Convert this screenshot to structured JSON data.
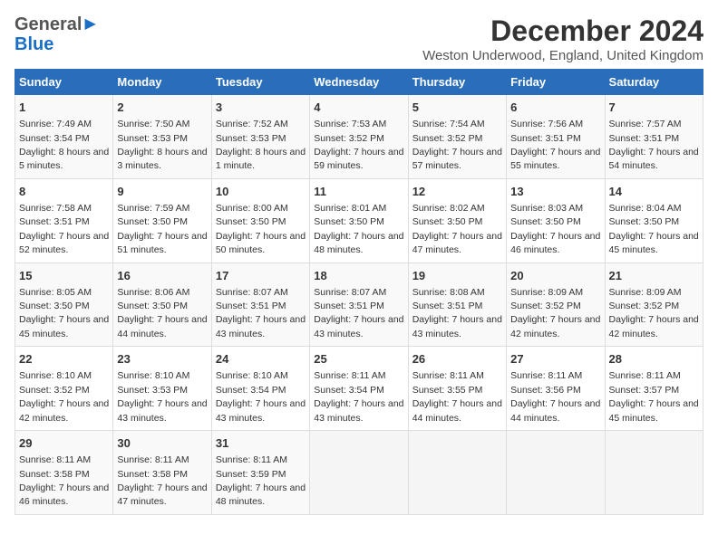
{
  "logo": {
    "line1": "General",
    "line2": "Blue",
    "icon": "▶"
  },
  "title": "December 2024",
  "subtitle": "Weston Underwood, England, United Kingdom",
  "weekdays": [
    "Sunday",
    "Monday",
    "Tuesday",
    "Wednesday",
    "Thursday",
    "Friday",
    "Saturday"
  ],
  "weeks": [
    [
      {
        "day": "1",
        "sunrise": "7:49 AM",
        "sunset": "3:54 PM",
        "daylight": "8 hours and 5 minutes."
      },
      {
        "day": "2",
        "sunrise": "7:50 AM",
        "sunset": "3:53 PM",
        "daylight": "8 hours and 3 minutes."
      },
      {
        "day": "3",
        "sunrise": "7:52 AM",
        "sunset": "3:53 PM",
        "daylight": "8 hours and 1 minute."
      },
      {
        "day": "4",
        "sunrise": "7:53 AM",
        "sunset": "3:52 PM",
        "daylight": "7 hours and 59 minutes."
      },
      {
        "day": "5",
        "sunrise": "7:54 AM",
        "sunset": "3:52 PM",
        "daylight": "7 hours and 57 minutes."
      },
      {
        "day": "6",
        "sunrise": "7:56 AM",
        "sunset": "3:51 PM",
        "daylight": "7 hours and 55 minutes."
      },
      {
        "day": "7",
        "sunrise": "7:57 AM",
        "sunset": "3:51 PM",
        "daylight": "7 hours and 54 minutes."
      }
    ],
    [
      {
        "day": "8",
        "sunrise": "7:58 AM",
        "sunset": "3:51 PM",
        "daylight": "7 hours and 52 minutes."
      },
      {
        "day": "9",
        "sunrise": "7:59 AM",
        "sunset": "3:50 PM",
        "daylight": "7 hours and 51 minutes."
      },
      {
        "day": "10",
        "sunrise": "8:00 AM",
        "sunset": "3:50 PM",
        "daylight": "7 hours and 50 minutes."
      },
      {
        "day": "11",
        "sunrise": "8:01 AM",
        "sunset": "3:50 PM",
        "daylight": "7 hours and 48 minutes."
      },
      {
        "day": "12",
        "sunrise": "8:02 AM",
        "sunset": "3:50 PM",
        "daylight": "7 hours and 47 minutes."
      },
      {
        "day": "13",
        "sunrise": "8:03 AM",
        "sunset": "3:50 PM",
        "daylight": "7 hours and 46 minutes."
      },
      {
        "day": "14",
        "sunrise": "8:04 AM",
        "sunset": "3:50 PM",
        "daylight": "7 hours and 45 minutes."
      }
    ],
    [
      {
        "day": "15",
        "sunrise": "8:05 AM",
        "sunset": "3:50 PM",
        "daylight": "7 hours and 45 minutes."
      },
      {
        "day": "16",
        "sunrise": "8:06 AM",
        "sunset": "3:50 PM",
        "daylight": "7 hours and 44 minutes."
      },
      {
        "day": "17",
        "sunrise": "8:07 AM",
        "sunset": "3:51 PM",
        "daylight": "7 hours and 43 minutes."
      },
      {
        "day": "18",
        "sunrise": "8:07 AM",
        "sunset": "3:51 PM",
        "daylight": "7 hours and 43 minutes."
      },
      {
        "day": "19",
        "sunrise": "8:08 AM",
        "sunset": "3:51 PM",
        "daylight": "7 hours and 43 minutes."
      },
      {
        "day": "20",
        "sunrise": "8:09 AM",
        "sunset": "3:52 PM",
        "daylight": "7 hours and 42 minutes."
      },
      {
        "day": "21",
        "sunrise": "8:09 AM",
        "sunset": "3:52 PM",
        "daylight": "7 hours and 42 minutes."
      }
    ],
    [
      {
        "day": "22",
        "sunrise": "8:10 AM",
        "sunset": "3:52 PM",
        "daylight": "7 hours and 42 minutes."
      },
      {
        "day": "23",
        "sunrise": "8:10 AM",
        "sunset": "3:53 PM",
        "daylight": "7 hours and 43 minutes."
      },
      {
        "day": "24",
        "sunrise": "8:10 AM",
        "sunset": "3:54 PM",
        "daylight": "7 hours and 43 minutes."
      },
      {
        "day": "25",
        "sunrise": "8:11 AM",
        "sunset": "3:54 PM",
        "daylight": "7 hours and 43 minutes."
      },
      {
        "day": "26",
        "sunrise": "8:11 AM",
        "sunset": "3:55 PM",
        "daylight": "7 hours and 44 minutes."
      },
      {
        "day": "27",
        "sunrise": "8:11 AM",
        "sunset": "3:56 PM",
        "daylight": "7 hours and 44 minutes."
      },
      {
        "day": "28",
        "sunrise": "8:11 AM",
        "sunset": "3:57 PM",
        "daylight": "7 hours and 45 minutes."
      }
    ],
    [
      {
        "day": "29",
        "sunrise": "8:11 AM",
        "sunset": "3:58 PM",
        "daylight": "7 hours and 46 minutes."
      },
      {
        "day": "30",
        "sunrise": "8:11 AM",
        "sunset": "3:58 PM",
        "daylight": "7 hours and 47 minutes."
      },
      {
        "day": "31",
        "sunrise": "8:11 AM",
        "sunset": "3:59 PM",
        "daylight": "7 hours and 48 minutes."
      },
      null,
      null,
      null,
      null
    ]
  ]
}
